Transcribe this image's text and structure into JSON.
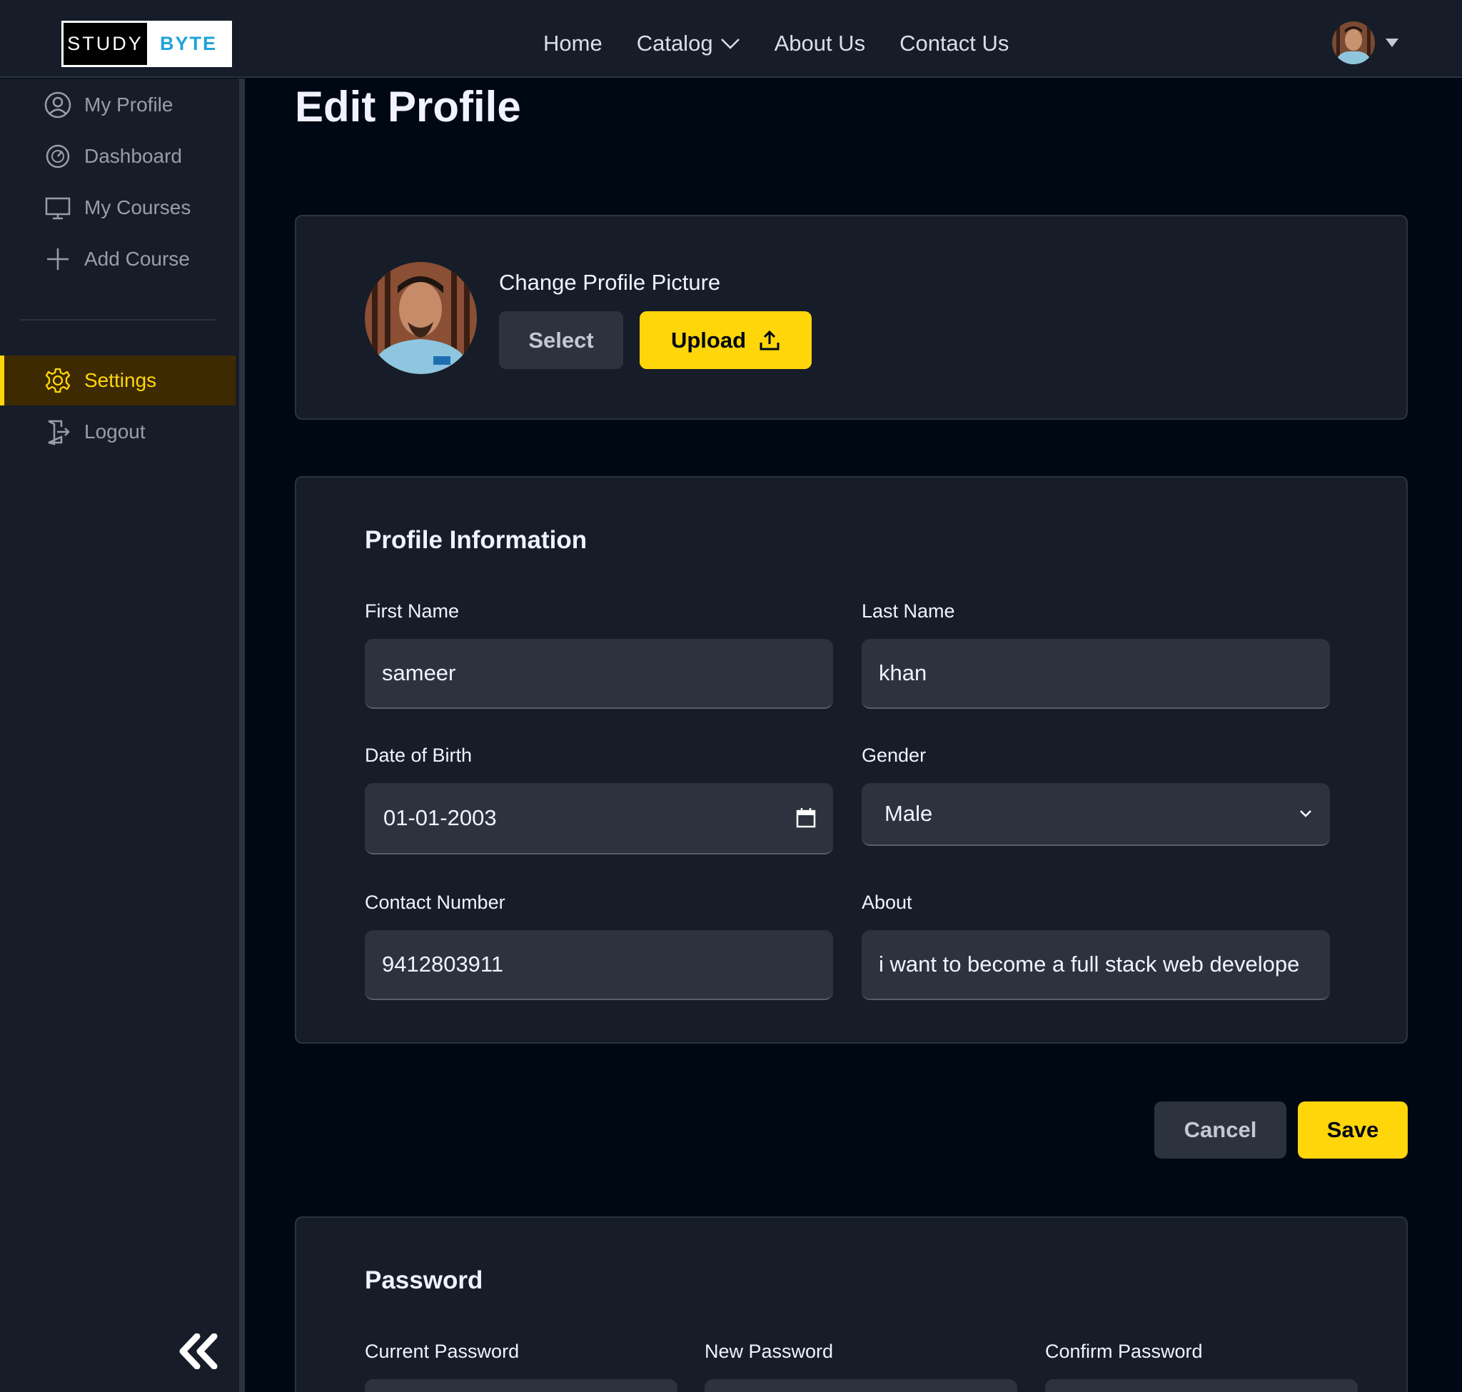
{
  "logo": {
    "part1": "STUDY",
    "part2": "BYTE"
  },
  "nav": {
    "home": "Home",
    "catalog": "Catalog",
    "about": "About Us",
    "contact": "Contact Us"
  },
  "sidebar": {
    "items": [
      {
        "label": "My Profile",
        "icon": "user-circle-icon"
      },
      {
        "label": "Dashboard",
        "icon": "gauge-icon"
      },
      {
        "label": "My Courses",
        "icon": "monitor-icon"
      },
      {
        "label": "Add Course",
        "icon": "plus-icon"
      }
    ],
    "settings": "Settings",
    "logout": "Logout"
  },
  "page": {
    "title": "Edit Profile"
  },
  "picture": {
    "label": "Change Profile Picture",
    "select": "Select",
    "upload": "Upload"
  },
  "profile": {
    "title": "Profile Information",
    "first_name_label": "First Name",
    "first_name": "sameer",
    "last_name_label": "Last Name",
    "last_name": "khan",
    "dob_label": "Date of Birth",
    "dob": "01-01-2003",
    "gender_label": "Gender",
    "gender": "Male",
    "contact_label": "Contact Number",
    "contact": "9412803911",
    "about_label": "About",
    "about": "i want to become a full stack web develope"
  },
  "actions": {
    "cancel": "Cancel",
    "save": "Save"
  },
  "password": {
    "title": "Password",
    "current": "Current Password",
    "new": "New Password",
    "confirm": "Confirm Password"
  },
  "colors": {
    "accent": "#ffd60a",
    "bg": "#000814",
    "panel": "#161d29",
    "field": "#2c333f"
  }
}
